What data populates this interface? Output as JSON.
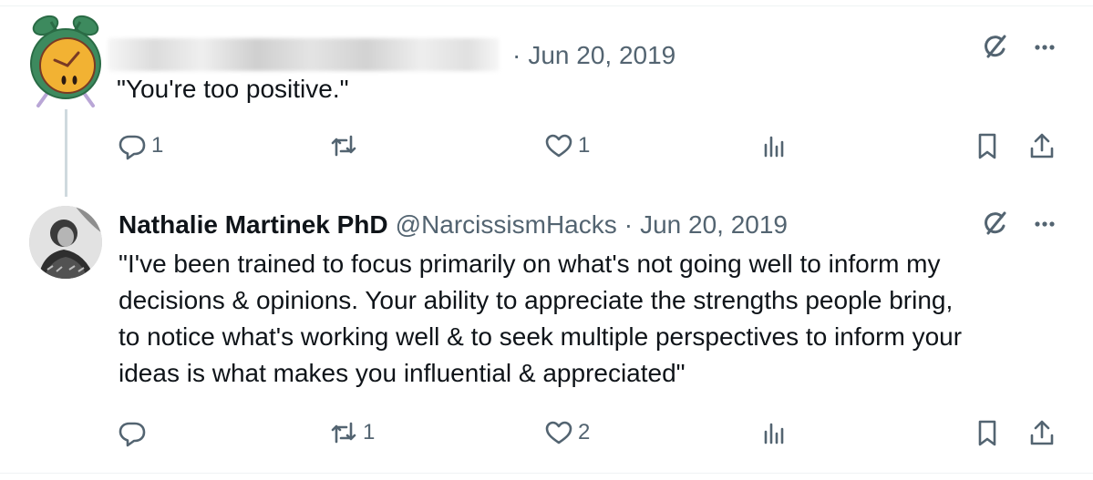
{
  "tweets": [
    {
      "display_name": "",
      "handle": "",
      "separator": "·",
      "date": "Jun 20, 2019",
      "text": "\"You're too positive.\"",
      "actions": {
        "reply_count": "1",
        "retweet_count": "",
        "like_count": "1"
      },
      "avatar_icon": "alarm-clock-avatar-icon"
    },
    {
      "display_name": "Nathalie Martinek PhD",
      "handle": "@NarcissismHacks",
      "separator": "·",
      "date": "Jun 20, 2019",
      "text": "\"I've been trained to focus primarily on what's not going well to inform my\ndecisions & opinions. Your ability to appreciate the strengths people bring,\nto notice what's working well & to seek multiple perspectives to inform your\nideas is what makes you influential & appreciated\"",
      "actions": {
        "reply_count": "",
        "retweet_count": "1",
        "like_count": "2"
      },
      "avatar_icon": "profile-photo"
    }
  ],
  "icons": {
    "reply": "reply-icon",
    "retweet": "retweet-icon",
    "like": "heart-icon",
    "views": "views-icon",
    "bookmark": "bookmark-icon",
    "share": "share-icon",
    "grok": "grok-icon",
    "more": "more-icon"
  },
  "colors": {
    "text_primary": "#0f1419",
    "text_secondary": "#536471",
    "thread_line": "#cfd9de",
    "avatar_green": "#3d8a5e",
    "avatar_yellow": "#f2b233"
  }
}
